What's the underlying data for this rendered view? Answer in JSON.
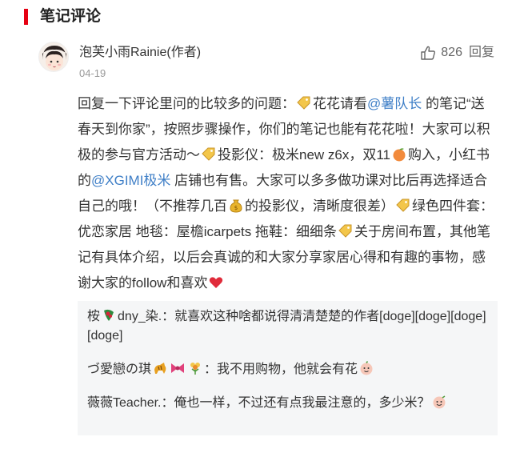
{
  "section": {
    "title": "笔记评论"
  },
  "comment": {
    "author": "泡芙小雨Rainie(作者)",
    "date": "04-19",
    "like_count": "826",
    "reply_label": "回复",
    "text": {
      "p1": "回复一下评论里问的比较多的问题：",
      "p2": "花花请看",
      "mention1": "@薯队长",
      "p3": " 的笔记“送春天到你家”，按照步骤操作，你们的笔记也能有花花啦！大家可以积极的参与官方活动～",
      "p4": "投影仪：极米new z6x，双11",
      "p5": "购入，小红书的",
      "mention2": "@XGIMI极米",
      "p6": " 店铺也有售。大家可以多多做功课对比后再选择适合自己的哦！（不推荐几百",
      "p7": "的投影仪，清晰度很差）",
      "p8": "绿色四件套：优恋家居 地毯：屋檐icarpets 拖鞋：细细条",
      "p9": "关于房间布置，其他笔记有具体介绍，以后会真诚的和大家分享家居心得和有趣的事物，感谢大家的follow和喜欢"
    }
  },
  "replies": [
    {
      "author_prefix": "桉",
      "author_suffix": "dny_染.",
      "text": "：就喜欢这种啥都说得清清楚楚的作者[doge][doge][doge][doge]"
    },
    {
      "author": "づ愛戀の琪",
      "text": "：我不用购物，他就会有花"
    },
    {
      "author": "薇薇Teacher.",
      "text": "：俺也一样，不过还有点我最注意的，多少米？"
    }
  ],
  "icons": [
    "thumbs-up-icon",
    "tag-icon",
    "peach-icon",
    "money-bag-icon",
    "heart-icon",
    "tiger-icon",
    "bow-icon",
    "bouquet-icon",
    "smile-icon"
  ],
  "colors": {
    "accent": "#e60012",
    "mention": "#3f7fc7",
    "reply_bg": "#f5f6f7"
  }
}
